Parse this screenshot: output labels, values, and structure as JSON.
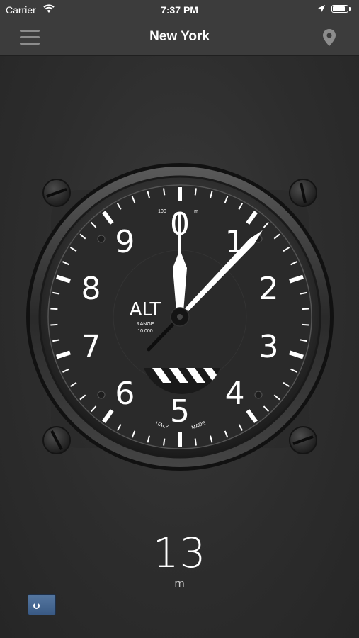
{
  "status_bar": {
    "carrier": "Carrier",
    "time": "7:37 PM"
  },
  "nav": {
    "title": "New York",
    "menu_icon": "hamburger-menu-icon",
    "location_icon": "map-pin-icon"
  },
  "gauge": {
    "dial_numbers": [
      "0",
      "1",
      "2",
      "3",
      "4",
      "5",
      "6",
      "7",
      "8",
      "9"
    ],
    "center_label": "ALT",
    "range_label": "RANGE",
    "range_value": "10.000",
    "top_left_scale": "100",
    "top_right_unit": "m",
    "bottom_left_text": "ITALY",
    "bottom_right_text": "MADE",
    "altitude_m": 13
  },
  "reading": {
    "value": "13",
    "unit": "m"
  },
  "refresh_icon": "refresh-icon",
  "colors": {
    "background": "#2e2e2e",
    "bar": "#3c3c3c",
    "dial_face": "#2a2a2a",
    "markings": "#ffffff"
  }
}
